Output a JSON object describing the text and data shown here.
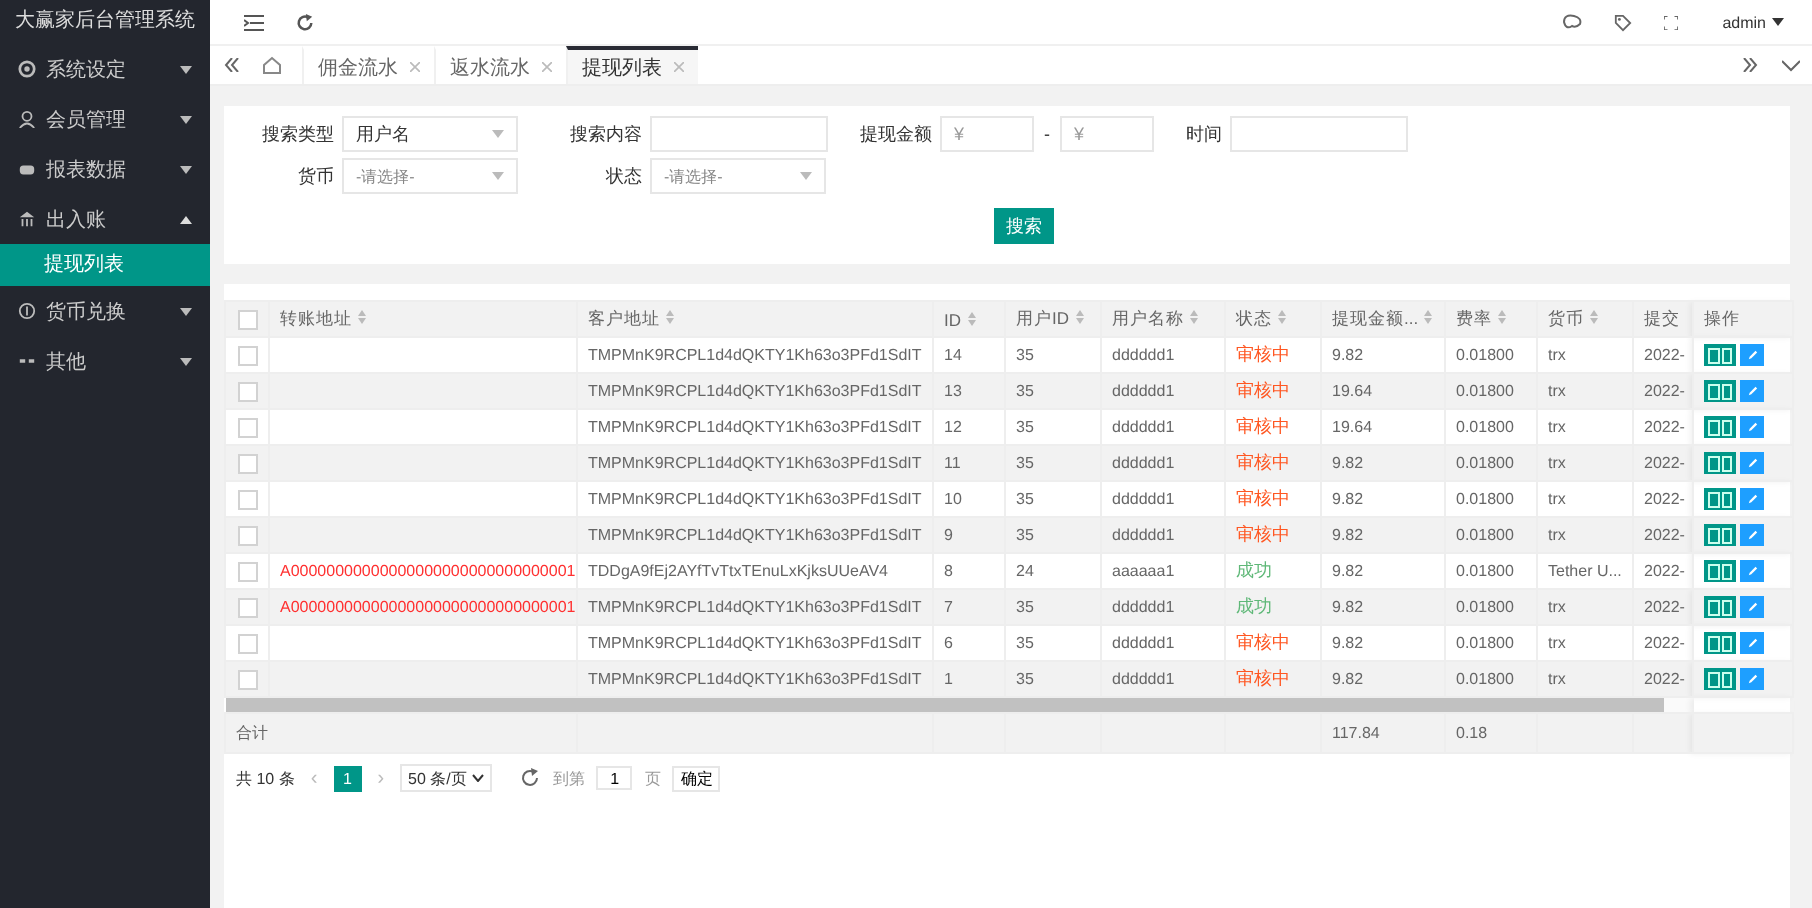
{
  "app_title": "大赢家后台管理系统",
  "sidebar": {
    "items": [
      {
        "label": "系统设定",
        "expanded": false
      },
      {
        "label": "会员管理",
        "expanded": false
      },
      {
        "label": "报表数据",
        "expanded": false
      },
      {
        "label": "出入账",
        "expanded": true,
        "children": [
          {
            "label": "提现列表",
            "selected": true
          }
        ]
      },
      {
        "label": "货币兑换",
        "expanded": false
      },
      {
        "label": "其他",
        "expanded": false
      }
    ]
  },
  "header": {
    "user": "admin"
  },
  "tabs": [
    {
      "label": "佣金流水",
      "selected": false
    },
    {
      "label": "返水流水",
      "selected": false
    },
    {
      "label": "提现列表",
      "selected": true
    }
  ],
  "search_form": {
    "type_label": "搜索类型",
    "type_value": "用户名",
    "content_label": "搜索内容",
    "amount_label": "提现金额",
    "amount_min_placeholder": "¥",
    "amount_separator": "-",
    "amount_max_placeholder": "¥",
    "time_label": "时间",
    "currency_label": "货币",
    "currency_placeholder": "-请选择-",
    "status_label": "状态",
    "status_placeholder": "-请选择-",
    "search_button": "搜索"
  },
  "table": {
    "select_all_checked": false,
    "columns": [
      {
        "label": "转账地址",
        "sortable": true
      },
      {
        "label": "客户地址",
        "sortable": true
      },
      {
        "label": "ID",
        "sortable": true
      },
      {
        "label": "用户ID",
        "sortable": true
      },
      {
        "label": "用户名称",
        "sortable": true
      },
      {
        "label": "状态",
        "sortable": true
      },
      {
        "label": "提现金额...",
        "sortable": true
      },
      {
        "label": "费率",
        "sortable": true
      },
      {
        "label": "货币",
        "sortable": true
      },
      {
        "label": "提交",
        "sortable": false
      },
      {
        "label": "操作",
        "sortable": false
      }
    ],
    "rows": [
      {
        "checked": false,
        "transfer_address": "",
        "customer_address": "TMPMnK9RCPL1d4dQKTY1Kh63o3PFd1SdIT",
        "id": "14",
        "user_id": "35",
        "username": "dddddd1",
        "status": {
          "text": "审核中",
          "color": "#ff5722"
        },
        "amount": "9.82",
        "rate": "0.01800",
        "currency": "trx",
        "submitted": "2022-"
      },
      {
        "checked": false,
        "transfer_address": "",
        "customer_address": "TMPMnK9RCPL1d4dQKTY1Kh63o3PFd1SdIT",
        "id": "13",
        "user_id": "35",
        "username": "dddddd1",
        "status": {
          "text": "审核中",
          "color": "#ff5722"
        },
        "amount": "19.64",
        "rate": "0.01800",
        "currency": "trx",
        "submitted": "2022-"
      },
      {
        "checked": false,
        "transfer_address": "",
        "customer_address": "TMPMnK9RCPL1d4dQKTY1Kh63o3PFd1SdIT",
        "id": "12",
        "user_id": "35",
        "username": "dddddd1",
        "status": {
          "text": "审核中",
          "color": "#ff5722"
        },
        "amount": "19.64",
        "rate": "0.01800",
        "currency": "trx",
        "submitted": "2022-"
      },
      {
        "checked": false,
        "transfer_address": "",
        "customer_address": "TMPMnK9RCPL1d4dQKTY1Kh63o3PFd1SdIT",
        "id": "11",
        "user_id": "35",
        "username": "dddddd1",
        "status": {
          "text": "审核中",
          "color": "#ff5722"
        },
        "amount": "9.82",
        "rate": "0.01800",
        "currency": "trx",
        "submitted": "2022-"
      },
      {
        "checked": false,
        "transfer_address": "",
        "customer_address": "TMPMnK9RCPL1d4dQKTY1Kh63o3PFd1SdIT",
        "id": "10",
        "user_id": "35",
        "username": "dddddd1",
        "status": {
          "text": "审核中",
          "color": "#ff5722"
        },
        "amount": "9.82",
        "rate": "0.01800",
        "currency": "trx",
        "submitted": "2022-"
      },
      {
        "checked": false,
        "transfer_address": "",
        "customer_address": "TMPMnK9RCPL1d4dQKTY1Kh63o3PFd1SdIT",
        "id": "9",
        "user_id": "35",
        "username": "dddddd1",
        "status": {
          "text": "审核中",
          "color": "#ff5722"
        },
        "amount": "9.82",
        "rate": "0.01800",
        "currency": "trx",
        "submitted": "2022-"
      },
      {
        "checked": false,
        "transfer_address": "A00000000000000000000000000000001",
        "customer_address": "TDDgA9fEj2AYfTvTtxTEnuLxKjksUUeAV4",
        "id": "8",
        "user_id": "24",
        "username": "aaaaaa1",
        "status": {
          "text": "成功",
          "color": "#5fb878"
        },
        "amount": "9.82",
        "rate": "0.01800",
        "currency": "Tether U...",
        "submitted": "2022-"
      },
      {
        "checked": false,
        "transfer_address": "A00000000000000000000000000000001",
        "customer_address": "TMPMnK9RCPL1d4dQKTY1Kh63o3PFd1SdIT",
        "id": "7",
        "user_id": "35",
        "username": "dddddd1",
        "status": {
          "text": "成功",
          "color": "#5fb878"
        },
        "amount": "9.82",
        "rate": "0.01800",
        "currency": "trx",
        "submitted": "2022-"
      },
      {
        "checked": false,
        "transfer_address": "",
        "customer_address": "TMPMnK9RCPL1d4dQKTY1Kh63o3PFd1SdIT",
        "id": "6",
        "user_id": "35",
        "username": "dddddd1",
        "status": {
          "text": "审核中",
          "color": "#ff5722"
        },
        "amount": "9.82",
        "rate": "0.01800",
        "currency": "trx",
        "submitted": "2022-"
      },
      {
        "checked": false,
        "transfer_address": "",
        "customer_address": "TMPMnK9RCPL1d4dQKTY1Kh63o3PFd1SdIT",
        "id": "1",
        "user_id": "35",
        "username": "dddddd1",
        "status": {
          "text": "审核中",
          "color": "#ff5722"
        },
        "amount": "9.82",
        "rate": "0.01800",
        "currency": "trx",
        "submitted": "2022-"
      }
    ],
    "totals": {
      "label": "合计",
      "amount": "117.84",
      "rate": "0.18"
    }
  },
  "pagination": {
    "total": "共 10 条",
    "prev": "‹",
    "pages": [
      {
        "label": "1",
        "selected": true
      }
    ],
    "next": "›",
    "page_size": "50 条/页",
    "goto_label": "到第",
    "goto_value": "1",
    "page_unit": "页",
    "confirm": "确定"
  }
}
